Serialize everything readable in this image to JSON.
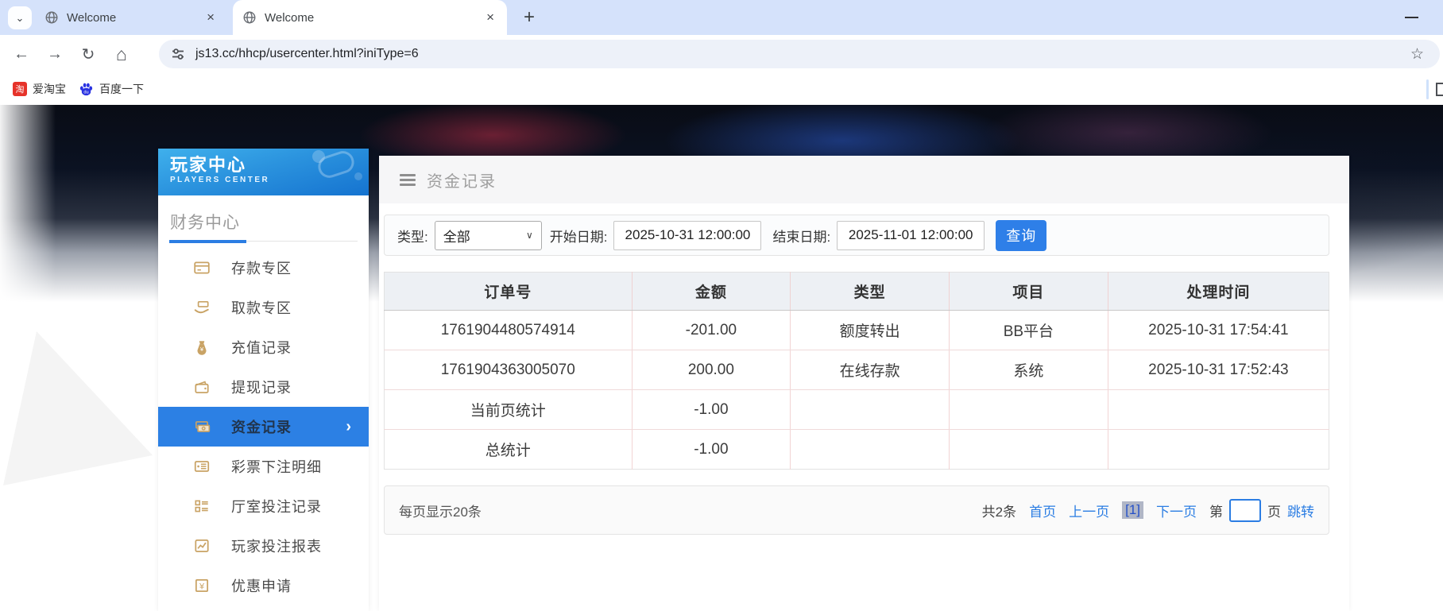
{
  "browser": {
    "tabs": [
      {
        "label": "Welcome",
        "active": false
      },
      {
        "label": "Welcome",
        "active": true
      }
    ],
    "url": "js13.cc/hhcp/usercenter.html?iniType=6",
    "icons": {
      "back": "←",
      "forward": "→",
      "reload": "↻",
      "home": "⌂",
      "star": "☆",
      "new_tab": "+",
      "close_tab": "×",
      "tab_search": "⌄"
    },
    "bookmarks": [
      {
        "label": "爱淘宝",
        "icon": "taobao-icon",
        "badge": "淘"
      },
      {
        "label": "百度一下",
        "icon": "baidu-paw-icon"
      }
    ]
  },
  "sidebar": {
    "title": "玩家中心",
    "subtitle": "PLAYERS CENTER",
    "section": "财务中心",
    "active_chevron": "›",
    "items": [
      {
        "label": "存款专区",
        "icon": "deposit-card-icon",
        "active": false
      },
      {
        "label": "取款专区",
        "icon": "withdraw-hand-icon",
        "active": false
      },
      {
        "label": "充值记录",
        "icon": "money-bag-icon",
        "active": false
      },
      {
        "label": "提现记录",
        "icon": "wallet-icon",
        "active": false
      },
      {
        "label": "资金记录",
        "icon": "banknotes-icon",
        "active": true
      },
      {
        "label": "彩票下注明细",
        "icon": "ticket-list-icon",
        "active": false
      },
      {
        "label": "厅室投注记录",
        "icon": "hall-list-icon",
        "active": false
      },
      {
        "label": "玩家投注报表",
        "icon": "report-chart-icon",
        "active": false
      },
      {
        "label": "优惠申请",
        "icon": "promo-yuan-icon",
        "active": false
      }
    ]
  },
  "main": {
    "header": {
      "title": "资金记录"
    },
    "filter": {
      "type_label": "类型:",
      "type_value": "全部",
      "start_label": "开始日期:",
      "start_value": "2025-10-31 12:00:00",
      "end_label": "结束日期:",
      "end_value": "2025-11-01 12:00:00",
      "search_label": "查询"
    },
    "table": {
      "columns": [
        "订单号",
        "金额",
        "类型",
        "项目",
        "处理时间"
      ],
      "col_widths": [
        "26.2%",
        "16.8%",
        "16.8%",
        "16.8%",
        "23.4%"
      ],
      "rows": [
        [
          "1761904480574914",
          "-201.00",
          "额度转出",
          "BB平台",
          "2025-10-31 17:54:41"
        ],
        [
          "1761904363005070",
          "200.00",
          "在线存款",
          "系统",
          "2025-10-31 17:52:43"
        ],
        [
          "当前页统计",
          "-1.00",
          "",
          "",
          ""
        ],
        [
          "总统计",
          "-1.00",
          "",
          "",
          ""
        ]
      ]
    },
    "pagination": {
      "per_page": "每页显示20条",
      "total": "共2条",
      "first": "首页",
      "prev": "上一页",
      "current": "[1]",
      "next": "下一页",
      "jump_pre": "第",
      "jump_value": "",
      "jump_post": "页",
      "jump_btn": "跳转"
    }
  },
  "colors": {
    "accent_blue": "#2b7de3",
    "sidebar_active": "#2c80e4",
    "icon_gold": "#c9a365",
    "table_border_pink": "#f2d4d4",
    "tabstrip_blue": "#d5e2fb"
  }
}
